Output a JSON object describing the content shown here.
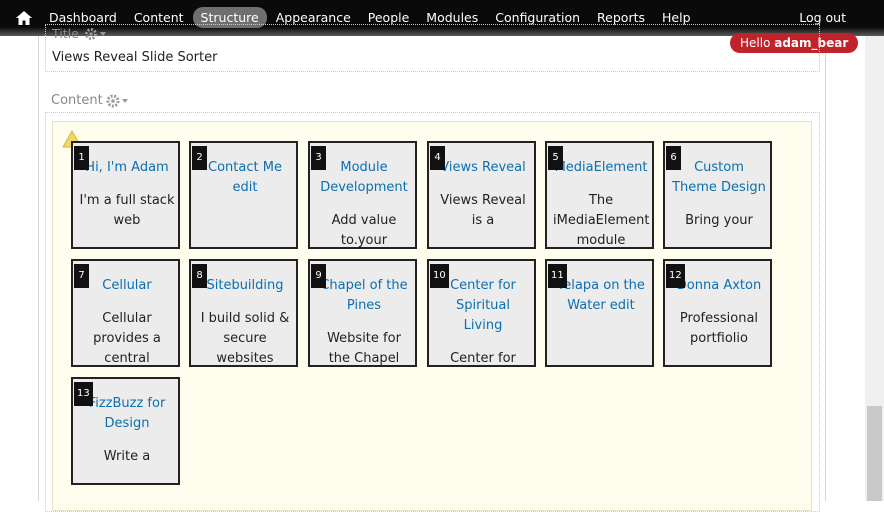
{
  "toolbar": {
    "home_icon": "home-icon",
    "items": [
      "Dashboard",
      "Content",
      "Structure",
      "Appearance",
      "People",
      "Modules",
      "Configuration",
      "Reports",
      "Help"
    ],
    "active": "Structure",
    "logout": "Log out"
  },
  "greeting": {
    "prefix": "Hello ",
    "user": "adam_bear",
    "color": "#c0232a"
  },
  "title_region": {
    "label": "Title",
    "value": "Views Reveal Slide Sorter"
  },
  "content_region": {
    "label": "Content"
  },
  "tiles": [
    {
      "num": "1",
      "title": "Hi, I'm Adam",
      "body": "I'm a full stack web"
    },
    {
      "num": "2",
      "title": "Contact Me edit",
      "body": ""
    },
    {
      "num": "3",
      "title": "Module Development",
      "body": "Add value to.your"
    },
    {
      "num": "4",
      "title": "Views Reveal",
      "body": "Views Reveal is a"
    },
    {
      "num": "5",
      "title": "MediaElement",
      "body": "The iMediaElement module"
    },
    {
      "num": "6",
      "title": "Custom Theme Design",
      "body": "Bring your"
    },
    {
      "num": "7",
      "title": "Cellular",
      "body": "Cellular provides a central"
    },
    {
      "num": "8",
      "title": "Sitebuilding",
      "body": "I build solid & secure websites"
    },
    {
      "num": "9",
      "title": "Chapel of the Pines",
      "body": "Website for the Chapel"
    },
    {
      "num": "10",
      "title": "Center for Spiritual Living",
      "body": "Center for"
    },
    {
      "num": "11",
      "title": "Yelapa on the Water edit",
      "body": ""
    },
    {
      "num": "12",
      "title": "Donna Axton",
      "body": "Professional portfiolio"
    },
    {
      "num": "13",
      "title": "FizzBuzz for Design",
      "body": "Write a"
    }
  ],
  "colors": {
    "link": "#0b6fb0",
    "toolbar": "#0a0a0a",
    "tile_bg": "#ececec",
    "region_bg": "#fefdee"
  }
}
